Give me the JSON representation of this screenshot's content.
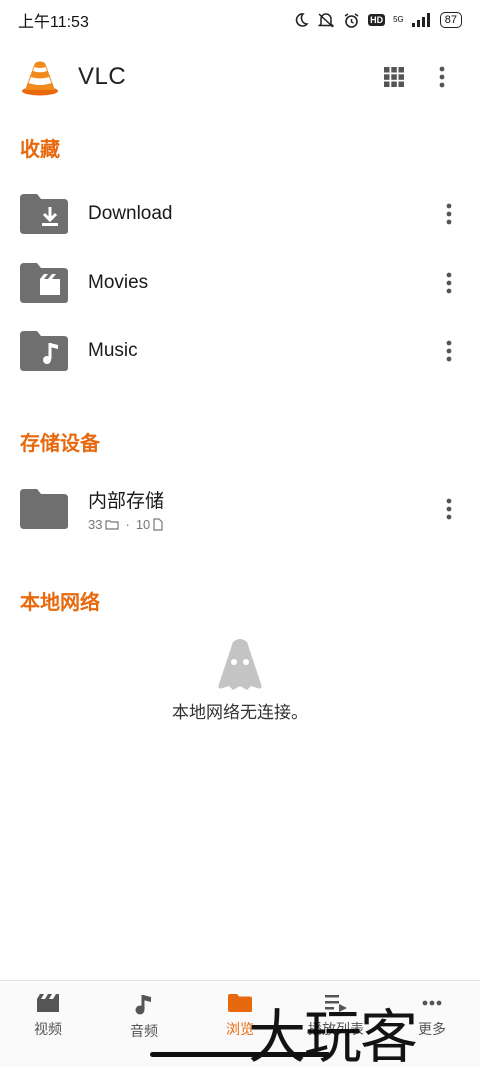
{
  "status": {
    "time": "上午11:53",
    "network": "5G",
    "battery": "87",
    "icons": [
      "moon-icon",
      "mute-icon",
      "alarm-icon",
      "hd-icon",
      "signal-icon",
      "battery-icon"
    ]
  },
  "appbar": {
    "title": "VLC",
    "logo": "vlc-cone-logo",
    "actions": [
      "grid-view-icon",
      "more-vert-icon"
    ]
  },
  "favorites": {
    "title": "收藏",
    "items": [
      {
        "label": "Download",
        "icon": "download-folder-icon"
      },
      {
        "label": "Movies",
        "icon": "movies-folder-icon"
      },
      {
        "label": "Music",
        "icon": "music-folder-icon"
      }
    ]
  },
  "storage": {
    "title": "存储设备",
    "items": [
      {
        "label": "内部存储",
        "folders": "33",
        "sep": "·",
        "files": "10"
      }
    ]
  },
  "network": {
    "title": "本地网络",
    "empty_message": "本地网络无连接。"
  },
  "bottom_nav": [
    {
      "label": "视频",
      "icon": "video-icon",
      "active": false
    },
    {
      "label": "音频",
      "icon": "music-note-icon",
      "active": false
    },
    {
      "label": "浏览",
      "icon": "folder-icon",
      "active": true
    },
    {
      "label": "播放列表",
      "icon": "playlist-icon",
      "active": false
    },
    {
      "label": "更多",
      "icon": "more-icon",
      "active": false
    }
  ],
  "watermark": "大玩客",
  "colors": {
    "accent": "#e8680d",
    "folder": "#6f6f6f"
  }
}
